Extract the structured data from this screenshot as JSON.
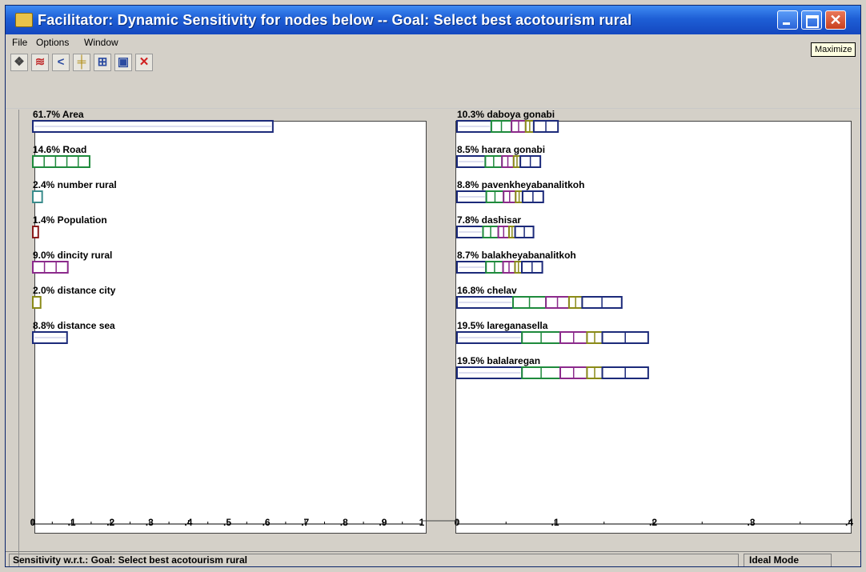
{
  "window": {
    "title": "Facilitator: Dynamic Sensitivity for nodes below -- Goal: Select best acotourism rural",
    "tooltip": "Maximize"
  },
  "menu": [
    "File",
    "Options",
    "Window"
  ],
  "toolbar": [
    {
      "icon": "node-icon"
    },
    {
      "icon": "graph-icon"
    },
    {
      "icon": "gradient-icon"
    },
    {
      "icon": "performance-icon"
    },
    {
      "icon": "two-dimensional-icon"
    },
    {
      "icon": "difference-icon"
    },
    {
      "icon": "close-icon"
    }
  ],
  "colors": {
    "navy": "#1c2a7a",
    "green": "#1e8a3c",
    "purple": "#8b2a8b",
    "maroon": "#8a1c1c",
    "olive": "#8a8a18",
    "teal": "#3a8c8c"
  },
  "chart_data": [
    {
      "type": "bar",
      "orientation": "horizontal",
      "xlim": [
        0,
        1
      ],
      "x_ticks": [
        "0",
        ".1",
        ".2",
        ".3",
        ".4",
        ".5",
        ".6",
        ".7",
        ".8",
        ".9",
        "1"
      ],
      "bars": [
        {
          "label": "61.7% Area",
          "value": 0.617,
          "color": "#1c2a7a",
          "style": "solid"
        },
        {
          "label": "14.6% Road",
          "value": 0.146,
          "color": "#1e8a3c",
          "style": "cells"
        },
        {
          "label": "2.4% number rural",
          "value": 0.024,
          "color": "#3a8c8c",
          "style": "solid"
        },
        {
          "label": "1.4% Population",
          "value": 0.014,
          "color": "#8a1c1c",
          "style": "solid"
        },
        {
          "label": "9.0% dincity rural",
          "value": 0.09,
          "color": "#8b2a8b",
          "style": "cells"
        },
        {
          "label": "2.0% distance city",
          "value": 0.02,
          "color": "#8a8a18",
          "style": "solid"
        },
        {
          "label": "8.8% distance sea",
          "value": 0.088,
          "color": "#1c2a7a",
          "style": "solid"
        }
      ]
    },
    {
      "type": "bar",
      "orientation": "horizontal",
      "stacked": true,
      "xlim": [
        0,
        0.4
      ],
      "x_ticks": [
        "0",
        ".1",
        ".2",
        ".3",
        ".4"
      ],
      "bars": [
        {
          "label": "10.3% daboya gonabi",
          "value": 0.103
        },
        {
          "label": "8.5% harara gonabi",
          "value": 0.085
        },
        {
          "label": "8.8% pavenkheyabanalitkoh",
          "value": 0.088
        },
        {
          "label": "7.8% dashisar",
          "value": 0.078
        },
        {
          "label": "8.7% balakheyabanalitkoh",
          "value": 0.087
        },
        {
          "label": "16.8% chelav",
          "value": 0.168
        },
        {
          "label": "19.5% lareganasella",
          "value": 0.195
        },
        {
          "label": "19.5% balalaregan",
          "value": 0.195
        }
      ],
      "segment_colors": [
        "#1c2a7a",
        "#1e8a3c",
        "#8b2a8b",
        "#8a8a18",
        "#1c2a7a"
      ]
    }
  ],
  "status": {
    "left": "Sensitivity w.r.t.: Goal: Select best acotourism rural",
    "right": "Ideal Mode"
  }
}
